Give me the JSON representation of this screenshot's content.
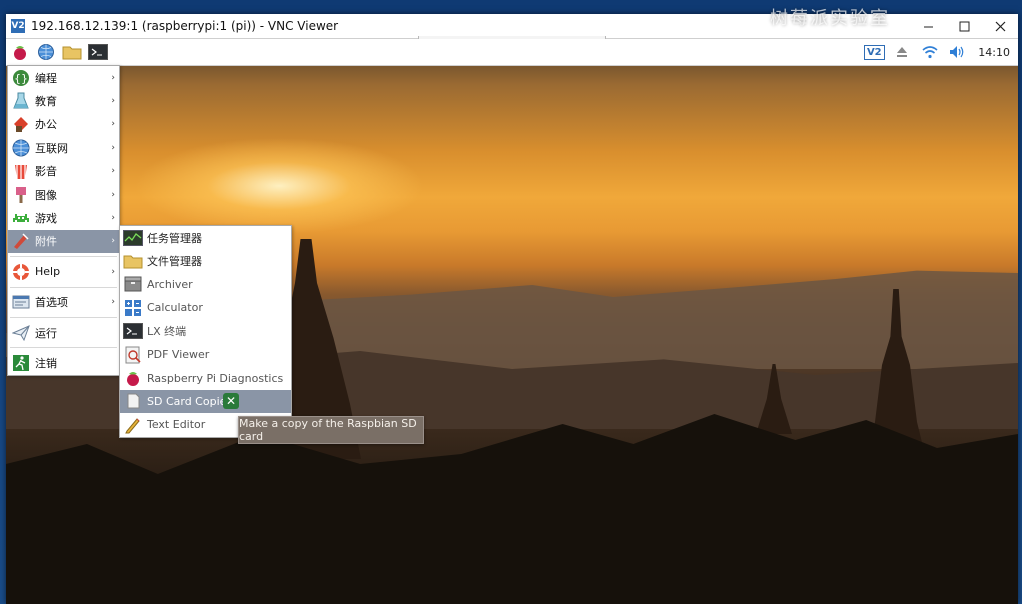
{
  "window": {
    "title": "192.168.12.139:1 (raspberrypi:1 (pi)) - VNC Viewer",
    "logo": "V2",
    "controls": [
      "minimize-icon",
      "maximize-icon",
      "close-icon"
    ]
  },
  "overlay": {
    "text": "树莓派实验室"
  },
  "panel": {
    "launchers": [
      "raspberry-menu-icon",
      "web-browser-icon",
      "file-manager-icon",
      "terminal-icon"
    ],
    "tray": {
      "vnc_badge": "V2",
      "icons": [
        "eject-icon",
        "wifi-icon",
        "volume-icon"
      ],
      "clock": "14:10"
    }
  },
  "main_menu": {
    "items": [
      {
        "label": "编程",
        "icon": "programming-icon",
        "has_submenu": true
      },
      {
        "label": "教育",
        "icon": "education-icon",
        "has_submenu": true
      },
      {
        "label": "办公",
        "icon": "office-icon",
        "has_submenu": true
      },
      {
        "label": "互联网",
        "icon": "internet-icon",
        "has_submenu": true
      },
      {
        "label": "影音",
        "icon": "sound-video-icon",
        "has_submenu": true
      },
      {
        "label": "图像",
        "icon": "graphics-icon",
        "has_submenu": true
      },
      {
        "label": "游戏",
        "icon": "games-icon",
        "has_submenu": true
      },
      {
        "label": "附件",
        "icon": "accessories-icon",
        "has_submenu": true,
        "selected": true
      },
      {
        "label": "Help",
        "icon": "help-icon",
        "has_submenu": true
      },
      {
        "label": "首选项",
        "icon": "preferences-icon",
        "has_submenu": true
      },
      {
        "label": "运行",
        "icon": "run-icon",
        "has_submenu": false
      },
      {
        "label": "注销",
        "icon": "logout-icon",
        "has_submenu": false
      }
    ]
  },
  "sub_menu": {
    "items": [
      {
        "label": "任务管理器",
        "icon": "task-manager-icon"
      },
      {
        "label": "文件管理器",
        "icon": "file-manager-icon"
      },
      {
        "label": "Archiver",
        "icon": "archiver-icon"
      },
      {
        "label": "Calculator",
        "icon": "calculator-icon"
      },
      {
        "label": "LX 终端",
        "icon": "terminal-icon"
      },
      {
        "label": "PDF Viewer",
        "icon": "pdf-viewer-icon"
      },
      {
        "label": "Raspberry Pi Diagnostics",
        "icon": "raspberry-icon"
      },
      {
        "label": "SD Card Copier",
        "icon": "sd-card-icon",
        "selected": true
      },
      {
        "label": "Text Editor",
        "icon": "text-editor-icon"
      }
    ]
  },
  "tooltip": {
    "text": "Make a copy of the Raspbian SD card"
  },
  "colors": {
    "menu_selected": "#8a95a6",
    "tooltip_bg": "#7a6f66"
  }
}
